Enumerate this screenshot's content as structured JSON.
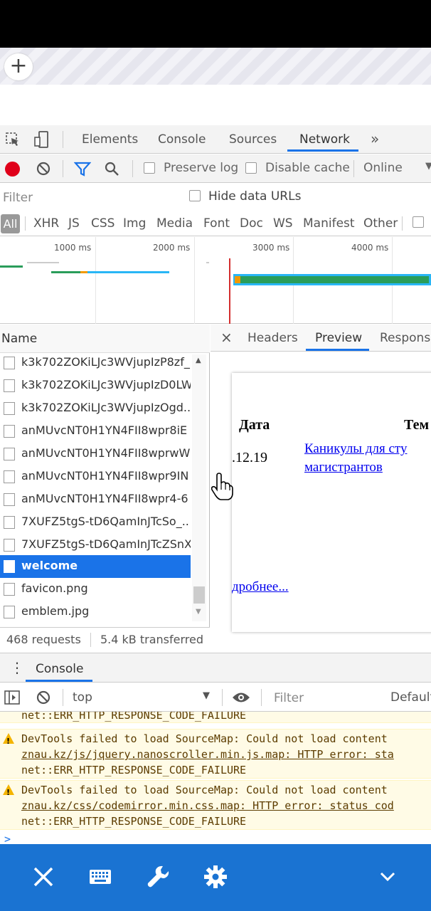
{
  "browser": {
    "new_tab_symbol": "+"
  },
  "devtools": {
    "tabs": [
      "Elements",
      "Console",
      "Sources",
      "Network"
    ],
    "more_tabs": "»",
    "active_tab": "Network",
    "toolbar": {
      "preserve_log": "Preserve log",
      "disable_cache": "Disable cache",
      "throttle": "Online"
    },
    "filter": {
      "placeholder": "Filter",
      "hide_data_urls": "Hide data URLs"
    },
    "type_filters": [
      "All",
      "XHR",
      "JS",
      "CSS",
      "Img",
      "Media",
      "Font",
      "Doc",
      "WS",
      "Manifest",
      "Other"
    ],
    "timeline_ticks": [
      "1000 ms",
      "2000 ms",
      "3000 ms",
      "4000 ms"
    ],
    "requests": {
      "header": "Name",
      "rows": [
        "k3k702ZOKiLJc3WVjupIzP8zf_",
        "k3k702ZOKiLJc3WVjupIzD0LW",
        "k3k702ZOKiLJc3WVjupIzOgd..",
        "anMUvcNT0H1YN4FII8wpr8iE",
        "anMUvcNT0H1YN4FII8wprwW",
        "anMUvcNT0H1YN4FII8wpr9IN",
        "anMUvcNT0H1YN4FII8wpr4-6",
        "7XUFZ5tgS-tD6QamInJTcSo_..",
        "7XUFZ5tgS-tD6QamInJTcZSnX",
        "welcome",
        "favicon.png",
        "emblem.jpg"
      ],
      "selected": "welcome",
      "footer_count": "468 requests",
      "footer_transferred": "5.4 kB transferred"
    },
    "detail_tabs": {
      "close": "×",
      "tabs": [
        "Headers",
        "Preview",
        "Response"
      ],
      "active": "Preview"
    },
    "preview": {
      "col_date": "Дата",
      "col_theme": "Тем",
      "date_value": ".12.19",
      "link_line1": "Каникулы для сту",
      "link_line2": "магистрантов",
      "more_link": "дробнее..."
    },
    "drawer": {
      "tab": "Console",
      "context": "top",
      "filter_placeholder": "Filter",
      "levels": "Default",
      "messages": [
        {
          "type": "plain",
          "lines": [
            "net::ERR_HTTP_RESPONSE_CODE_FAILURE"
          ]
        },
        {
          "type": "warning",
          "lines": [
            "DevTools failed to load SourceMap: Could not load content",
            "znau.kz/js/jquery.nanoscroller.min.js.map: HTTP error: sta",
            "net::ERR_HTTP_RESPONSE_CODE_FAILURE"
          ]
        },
        {
          "type": "warning",
          "lines": [
            "DevTools failed to load SourceMap: Could not load content",
            "znau.kz/css/codemirror.min.css.map: HTTP error: status cod",
            "net::ERR_HTTP_RESPONSE_CODE_FAILURE"
          ]
        }
      ],
      "prompt": ">"
    }
  },
  "bottom_bar": {
    "icons": [
      "close-icon",
      "keyboard-icon",
      "wrench-icon",
      "gear-icon",
      "chevron-down-icon"
    ],
    "accent": "#1a73d2"
  }
}
